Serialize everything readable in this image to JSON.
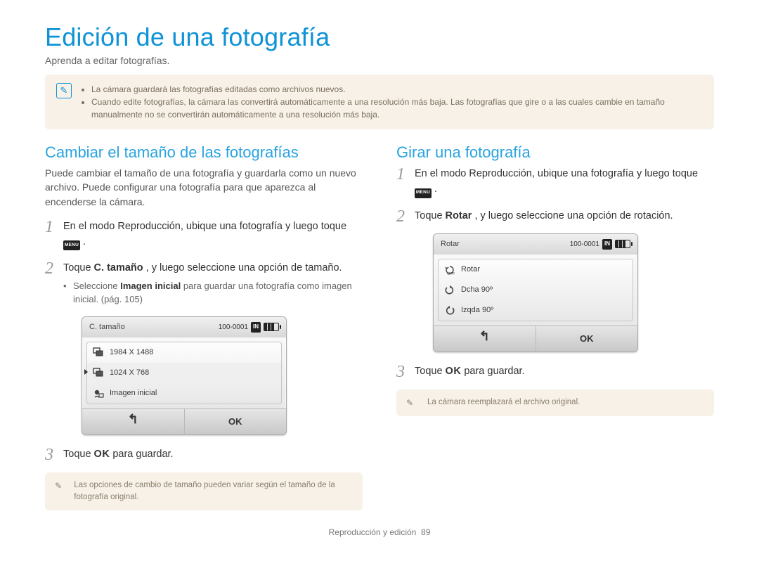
{
  "page": {
    "title": "Edición de una fotografía",
    "subtitle": "Aprenda a editar fotografías.",
    "footer_section": "Reproducción y edición",
    "page_number": "89"
  },
  "topnote": {
    "bullet1": "La cámara guardará las fotografías editadas como archivos nuevos.",
    "bullet2": "Cuando edite fotografías, la cámara las convertirá automáticamente a una resolución más baja. Las fotografías que gire o a las cuales cambie en tamaño manualmente no se convertirán automáticamente a una resolución más baja."
  },
  "left": {
    "heading": "Cambiar el tamaño de las fotografías",
    "body": "Puede cambiar el tamaño de una fotografía y guardarla como un nuevo archivo. Puede configurar una fotografía para que aparezca al encenderse la cámara.",
    "step1a": "En el modo Reproducción, ubique una fotografía y luego toque ",
    "step2a": "Toque ",
    "step2b": "C. tamaño",
    "step2c": ", y luego seleccione una opción de tamaño.",
    "sub_a": "Seleccione ",
    "sub_b": "Imagen inicial",
    "sub_c": " para guardar una fotografía como imagen inicial. (pág. 105)",
    "step3a": "Toque ",
    "step3c": " para guardar.",
    "panel": {
      "title": "C. tamaño",
      "fileno": "100-0001",
      "opt1": "1984 X 1488",
      "opt2": "1024 X 768",
      "opt3": "Imagen inicial",
      "ok": "OK"
    },
    "note": "Las opciones de cambio de tamaño pueden variar según el tamaño de la fotografía original."
  },
  "right": {
    "heading": "Girar una fotografía",
    "step1a": "En el modo Reproducción, ubique una fotografía y luego toque ",
    "step2a": "Toque ",
    "step2b": "Rotar",
    "step2c": ", y luego seleccione una opción de rotación.",
    "step3a": "Toque ",
    "step3c": " para guardar.",
    "panel": {
      "title": "Rotar",
      "fileno": "100-0001",
      "opt1": "Rotar",
      "opt2": "Dcha 90º",
      "opt3": "Izqda 90º",
      "ok": "OK"
    },
    "note": "La cámara reemplazará el archivo original."
  },
  "labels": {
    "menu": "MENU",
    "in": "IN",
    "ok": "OK"
  }
}
